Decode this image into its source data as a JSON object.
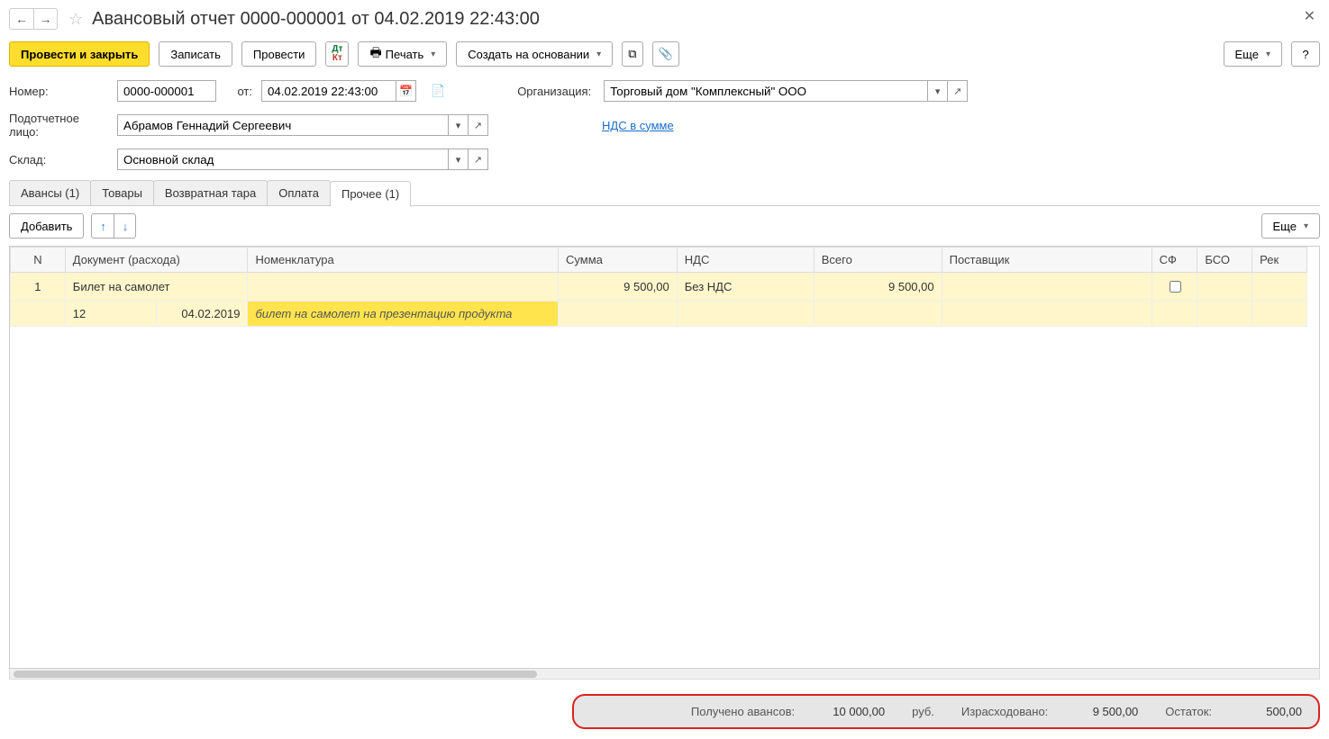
{
  "header": {
    "title": "Авансовый отчет 0000-000001 от 04.02.2019 22:43:00"
  },
  "toolbar": {
    "post_close": "Провести и закрыть",
    "save": "Записать",
    "post": "Провести",
    "print": "Печать",
    "create_based": "Создать на основании",
    "more": "Еще",
    "help": "?"
  },
  "form": {
    "number_label": "Номер:",
    "number_value": "0000-000001",
    "from_label": "от:",
    "date_value": "04.02.2019 22:43:00",
    "org_label": "Организация:",
    "org_value": "Торговый дом \"Комплексный\" ООО",
    "person_label": "Подотчетное лицо:",
    "person_value": "Абрамов Геннадий Сергеевич",
    "vat_link": "НДС в сумме",
    "warehouse_label": "Склад:",
    "warehouse_value": "Основной склад"
  },
  "tabs": {
    "t0": "Авансы (1)",
    "t1": "Товары",
    "t2": "Возвратная тара",
    "t3": "Оплата",
    "t4": "Прочее (1)"
  },
  "tab_toolbar": {
    "add": "Добавить",
    "more": "Еще"
  },
  "grid": {
    "cols": {
      "n": "N",
      "doc": "Документ (расхода)",
      "nomen": "Номенклатура",
      "sum": "Сумма",
      "vat": "НДС",
      "total": "Всего",
      "supplier": "Поставщик",
      "sf": "СФ",
      "bso": "БСО",
      "rek": "Рек"
    },
    "rows": [
      {
        "n": "1",
        "doc": "Билет на самолет",
        "doc_sub_num": "12",
        "doc_sub_date": "04.02.2019",
        "nomen_sub": "билет на самолет на презентацию продукта",
        "sum": "9 500,00",
        "vat": "Без НДС",
        "total": "9 500,00",
        "sf_checked": false
      }
    ]
  },
  "footer": {
    "received_label": "Получено авансов:",
    "received_value": "10 000,00",
    "currency": "руб.",
    "spent_label": "Израсходовано:",
    "spent_value": "9 500,00",
    "balance_label": "Остаток:",
    "balance_value": "500,00"
  }
}
